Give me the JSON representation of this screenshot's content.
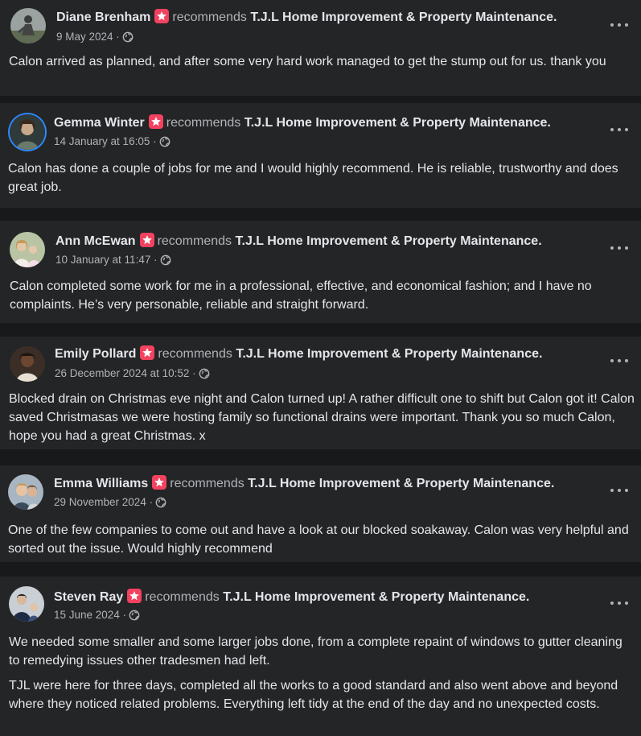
{
  "reviews": [
    {
      "name": "Diane Brenham",
      "action": "recommends",
      "page": "T.J.L Home Improvement & Property Maintenance.",
      "date": "9 May 2024 ·",
      "text": [
        "Calon arrived as planned, and after some very hard work managed to get the stump out for us. thank you"
      ]
    },
    {
      "name": "Gemma Winter",
      "action": "recommends",
      "page": "T.J.L Home Improvement & Property Maintenance.",
      "date": "14 January at 16:05 ·",
      "text": [
        "Calon has done a couple of jobs for me and I would highly recommend. He is reliable, trustworthy and does great job."
      ]
    },
    {
      "name": "Ann McEwan",
      "action": "recommends",
      "page": "T.J.L Home Improvement & Property Maintenance.",
      "date": "10 January at 11:47 ·",
      "text": [
        "Calon completed some work for me in a professional, effective, and economical fashion; and I have no complaints. He’s very personable, reliable and straight forward."
      ]
    },
    {
      "name": "Emily Pollard",
      "action": "recommends",
      "page": "T.J.L Home Improvement & Property Maintenance.",
      "date": "26 December 2024 at 10:52 ·",
      "text": [
        "Blocked drain on Christmas eve night and Calon turned up! A rather difficult one to shift but Calon got it! Calon saved Christmasas we were hosting family so functional drains were important. Thank you so much Calon, hope you had a great Christmas. x"
      ]
    },
    {
      "name": "Emma Williams",
      "action": "recommends",
      "page": "T.J.L Home Improvement & Property Maintenance.",
      "date": "29 November 2024 ·",
      "text": [
        "One of the few companies to come out and have a look at our blocked soakaway. Calon was very helpful and sorted out the issue. Would highly recommend"
      ]
    },
    {
      "name": "Steven Ray",
      "action": "recommends",
      "page": "T.J.L Home Improvement & Property Maintenance.",
      "date": "15 June 2024 ·",
      "text": [
        "We needed some smaller and some larger jobs done, from a complete repaint of windows to gutter cleaning to remedying issues other tradesmen had left.",
        "TJL were here for three days, completed all the works to a good standard and also went above and beyond where they noticed related problems. Everything left tidy at the end of the day and no unexpected costs."
      ]
    }
  ],
  "colors": {
    "background": "#18191a",
    "card": "#242526",
    "primary_text": "#e4e6eb",
    "secondary_text": "#b0b3b8",
    "recommend_badge": "#f3425f",
    "story_ring": "#2d88ff"
  },
  "icons": {
    "recommend": "recommend-star-icon",
    "audience": "globe-icon",
    "menu": "more-horizontal-icon"
  }
}
